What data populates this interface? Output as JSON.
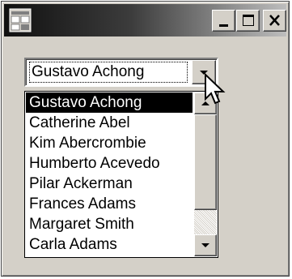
{
  "window": {
    "title": "",
    "icons": {
      "app": "app-window-icon",
      "minimize": "minimize-icon",
      "maximize": "maximize-icon",
      "close": "close-icon"
    }
  },
  "combo": {
    "selected_value": "Gustavo Achong",
    "dropdown_icon": "chevron-down-icon",
    "expanded": true
  },
  "list": {
    "items": [
      "Gustavo Achong",
      "Catherine Abel",
      "Kim Abercrombie",
      "Humberto Acevedo",
      "Pilar Ackerman",
      "Frances Adams",
      "Margaret Smith",
      "Carla Adams"
    ],
    "selected_index": 0,
    "scroll_position": 0,
    "visible_fraction": 0.66
  },
  "colors": {
    "face": "#d4d0c8",
    "selection": "#000000",
    "selection_text": "#ffffff"
  }
}
